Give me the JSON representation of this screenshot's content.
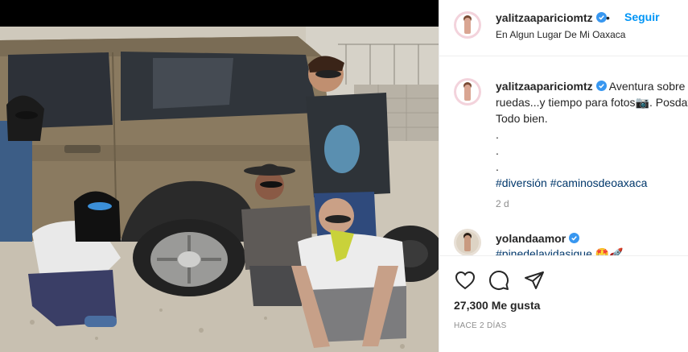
{
  "post": {
    "username": "yalitzaapariciomtz",
    "follow_label": "Seguir",
    "separator": "•",
    "location": "En Algun Lugar De Mi Oaxaca",
    "caption_text": "Aventura sobre ruedas...y tiempo para fotos📷. Posdata: Todo bien.",
    "caption_dots": [
      ".",
      ".",
      "."
    ],
    "hashtag_1": "#diversión",
    "hashtag_2": "#caminosdeoaxaca",
    "caption_time": "2 d",
    "likes": "27,300 Me gusta",
    "posted": "HACE 2 DÍAS"
  },
  "comment": {
    "username": "yolandaamor",
    "text": "#pinedelavidasigue 🤩🚀"
  },
  "icons": {
    "verified": "verified-badge-icon",
    "like": "heart-icon",
    "comment": "comment-bubble-icon",
    "share": "paper-plane-icon"
  },
  "colors": {
    "link_blue": "#0095f6",
    "hashtag": "#00376b",
    "muted": "#8e8e8e",
    "verified": "#3897f0"
  }
}
